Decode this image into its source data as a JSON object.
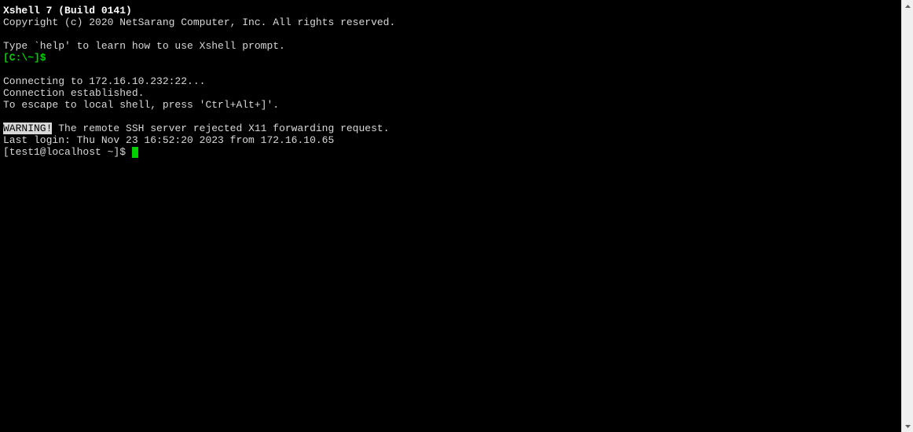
{
  "header": {
    "title": "Xshell 7 (Build 0141)",
    "copyright": "Copyright (c) 2020 NetSarang Computer, Inc. All rights reserved."
  },
  "help_hint": "Type `help' to learn how to use Xshell prompt.",
  "local_prompt": "[C:\\~]$ ",
  "connection": {
    "connecting": "Connecting to 172.16.10.232:22...",
    "established": "Connection established.",
    "escape_hint": "To escape to local shell, press 'Ctrl+Alt+]'."
  },
  "warning": {
    "label": "WARNING!",
    "text": " The remote SSH server rejected X11 forwarding request."
  },
  "last_login": "Last login: Thu Nov 23 16:52:20 2023 from 172.16.10.65",
  "remote_prompt": "[test1@localhost ~]$ ",
  "colors": {
    "bg": "#000000",
    "fg": "#d8d8d8",
    "green": "#00d000",
    "bold_white": "#ffffff"
  }
}
